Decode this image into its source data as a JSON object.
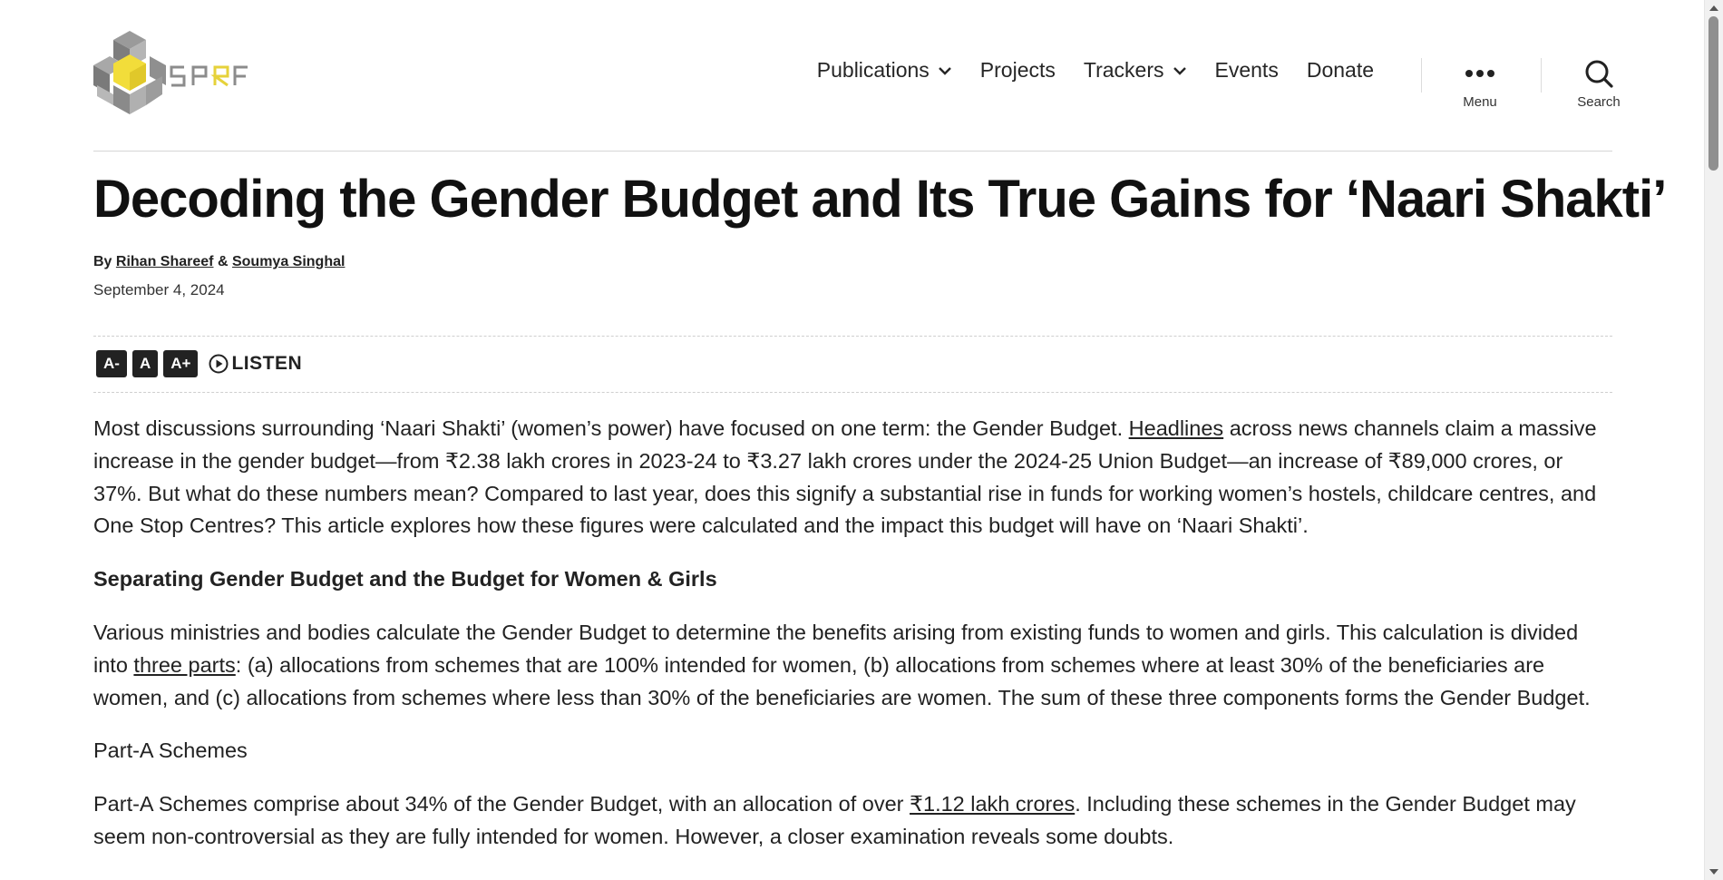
{
  "site": {
    "logo_text": "SPRF"
  },
  "nav": {
    "items": [
      {
        "label": "Publications",
        "has_dropdown": true
      },
      {
        "label": "Projects",
        "has_dropdown": false
      },
      {
        "label": "Trackers",
        "has_dropdown": true
      },
      {
        "label": "Events",
        "has_dropdown": false
      },
      {
        "label": "Donate",
        "has_dropdown": false
      }
    ],
    "menu_label": "Menu",
    "search_label": "Search"
  },
  "article": {
    "title": "Decoding the Gender Budget and Its True Gains for ‘Naari Shakti’",
    "byline_prefix": "By",
    "author1": "Rihan Shareef",
    "author_sep": "&",
    "author2": "Soumya Singhal",
    "date": "September 4, 2024"
  },
  "tools": {
    "decrease": "A-",
    "normal": "A",
    "increase": "A+",
    "listen": "LISTEN"
  },
  "content": {
    "p1_a": "Most discussions surrounding ‘Naari Shakti’ (women’s power) have focused on one term: the Gender Budget. ",
    "p1_link": "Headlines",
    "p1_b": " across news channels claim a massive increase in the gender budget—from ₹2.38 lakh crores in 2023-24 to ₹3.27 lakh crores under the 2024-25 Union Budget—an increase of ₹89,000 crores, or 37%. But what do these numbers mean? Compared to last year, does this signify a substantial rise in funds for working women’s hostels, childcare centres, and One Stop Centres? This article explores how these figures were calculated and the impact this budget will have on ‘Naari Shakti’.",
    "h1": "Separating Gender Budget and the Budget for Women & Girls",
    "p2_a": "Various ministries and bodies calculate the Gender Budget to determine the benefits arising from existing funds to women and girls. This calculation is divided into ",
    "p2_link": "three parts",
    "p2_b": ": (a) allocations from schemes that are 100% intended for women, (b) allocations from schemes where at least 30% of the beneficiaries are women, and (c) allocations from schemes where less than 30% of the beneficiaries are women. The sum of these three components forms the Gender Budget.",
    "p3": "Part-A Schemes",
    "p4_a": "Part-A Schemes comprise about 34% of the Gender Budget, with an allocation of over ",
    "p4_link": "₹1.12 lakh crores",
    "p4_b": ". Including these schemes in the Gender Budget may seem non-controversial as they are fully intended for women. However, a closer examination reveals some doubts."
  },
  "colors": {
    "logo_yellow": "#f2dd3a",
    "logo_gray": "#8c8c8c",
    "text": "#222222"
  }
}
